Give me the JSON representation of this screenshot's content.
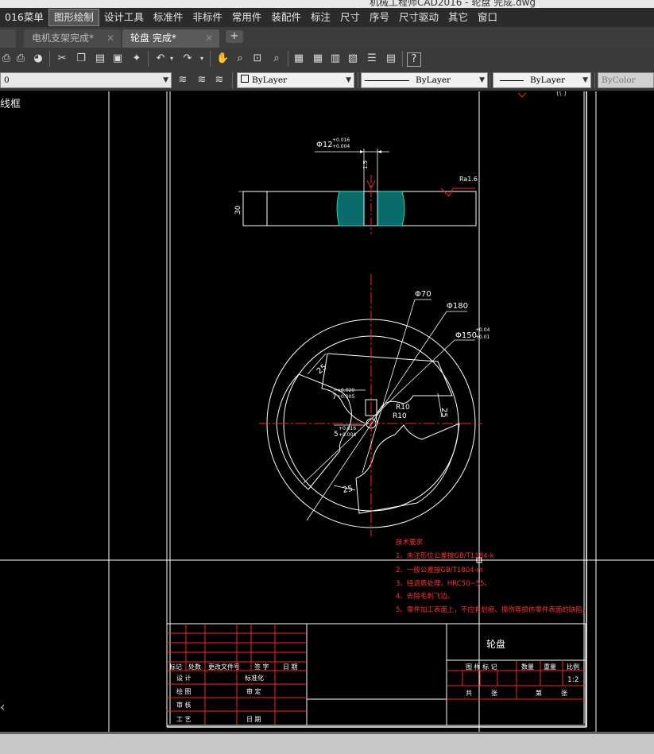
{
  "window": {
    "title": "机械工程师CAD2016 - 轮盘 完成.dwg"
  },
  "menu": [
    "016菜单",
    "图形绘制",
    "设计工具",
    "标准件",
    "非标件",
    "常用件",
    "装配件",
    "标注",
    "尺寸",
    "序号",
    "尺寸驱动",
    "其它",
    "窗口"
  ],
  "tabs": [
    {
      "label": "电机支架完成*",
      "close": "✕",
      "active": false
    },
    {
      "label": "轮盘 完成*",
      "close": "✕",
      "active": true
    }
  ],
  "new_tab": "+",
  "layer": {
    "value": "0"
  },
  "properties": {
    "color": "ByLayer",
    "linetype": "ByLayer",
    "lineweight": "ByLayer",
    "plotstyle": "ByColor"
  },
  "canvas": {
    "left_label": "线框",
    "corner_mark": "(\\ )",
    "colors": {
      "line": "#ffffff",
      "red": "#ff2020",
      "hatch": "#20c8c8",
      "tech": "#ff3030"
    }
  },
  "drawing": {
    "dims": {
      "d12": "Φ12",
      "d12_tol_upper": "+0.016",
      "d12_tol_lower": "+0.004",
      "depth": "1.5",
      "thickness": "30",
      "roughness": "Ra1.6",
      "d70": "Φ70",
      "d180": "Φ180",
      "d150": "Φ150",
      "d150_tol_upper": "+0.04",
      "d150_tol_lower": "+0.01",
      "w25a": "25",
      "w25b": "25",
      "w25c": "25",
      "r10a": "R10",
      "r10b": "R10",
      "key7": "7",
      "key7_tol_upper": "+0.020",
      "key7_tol_lower": "+0.005",
      "key5": "5",
      "key5_tol_upper": "+0.016",
      "key5_tol_lower": "+0.004"
    },
    "tech_requirements": {
      "title": "技术要求",
      "items": [
        "1、未注形位公差按GB/T1184-k",
        "2、一般公差按GB/T1804-m",
        "3、经调质处理，HRC50~55。",
        "4、去除毛刺飞边。",
        "5、零件加工表面上，不应有划痕、擦伤等损伤零件表面的缺陷。"
      ]
    },
    "title_block": {
      "part_name": "轮盘",
      "rev_header": [
        "标记",
        "处数",
        "更改文件号",
        "签 字",
        "日 期"
      ],
      "roles": [
        "设 计",
        "绘 图",
        "审 核",
        "工 艺"
      ],
      "roles2": [
        "标准化",
        "审 定",
        "日 期"
      ],
      "stage_header": [
        "图 样 标 记",
        "数量",
        "重量",
        "比例"
      ],
      "scale": "1:2",
      "sheet": [
        "共",
        "张",
        "第",
        "张"
      ]
    }
  }
}
